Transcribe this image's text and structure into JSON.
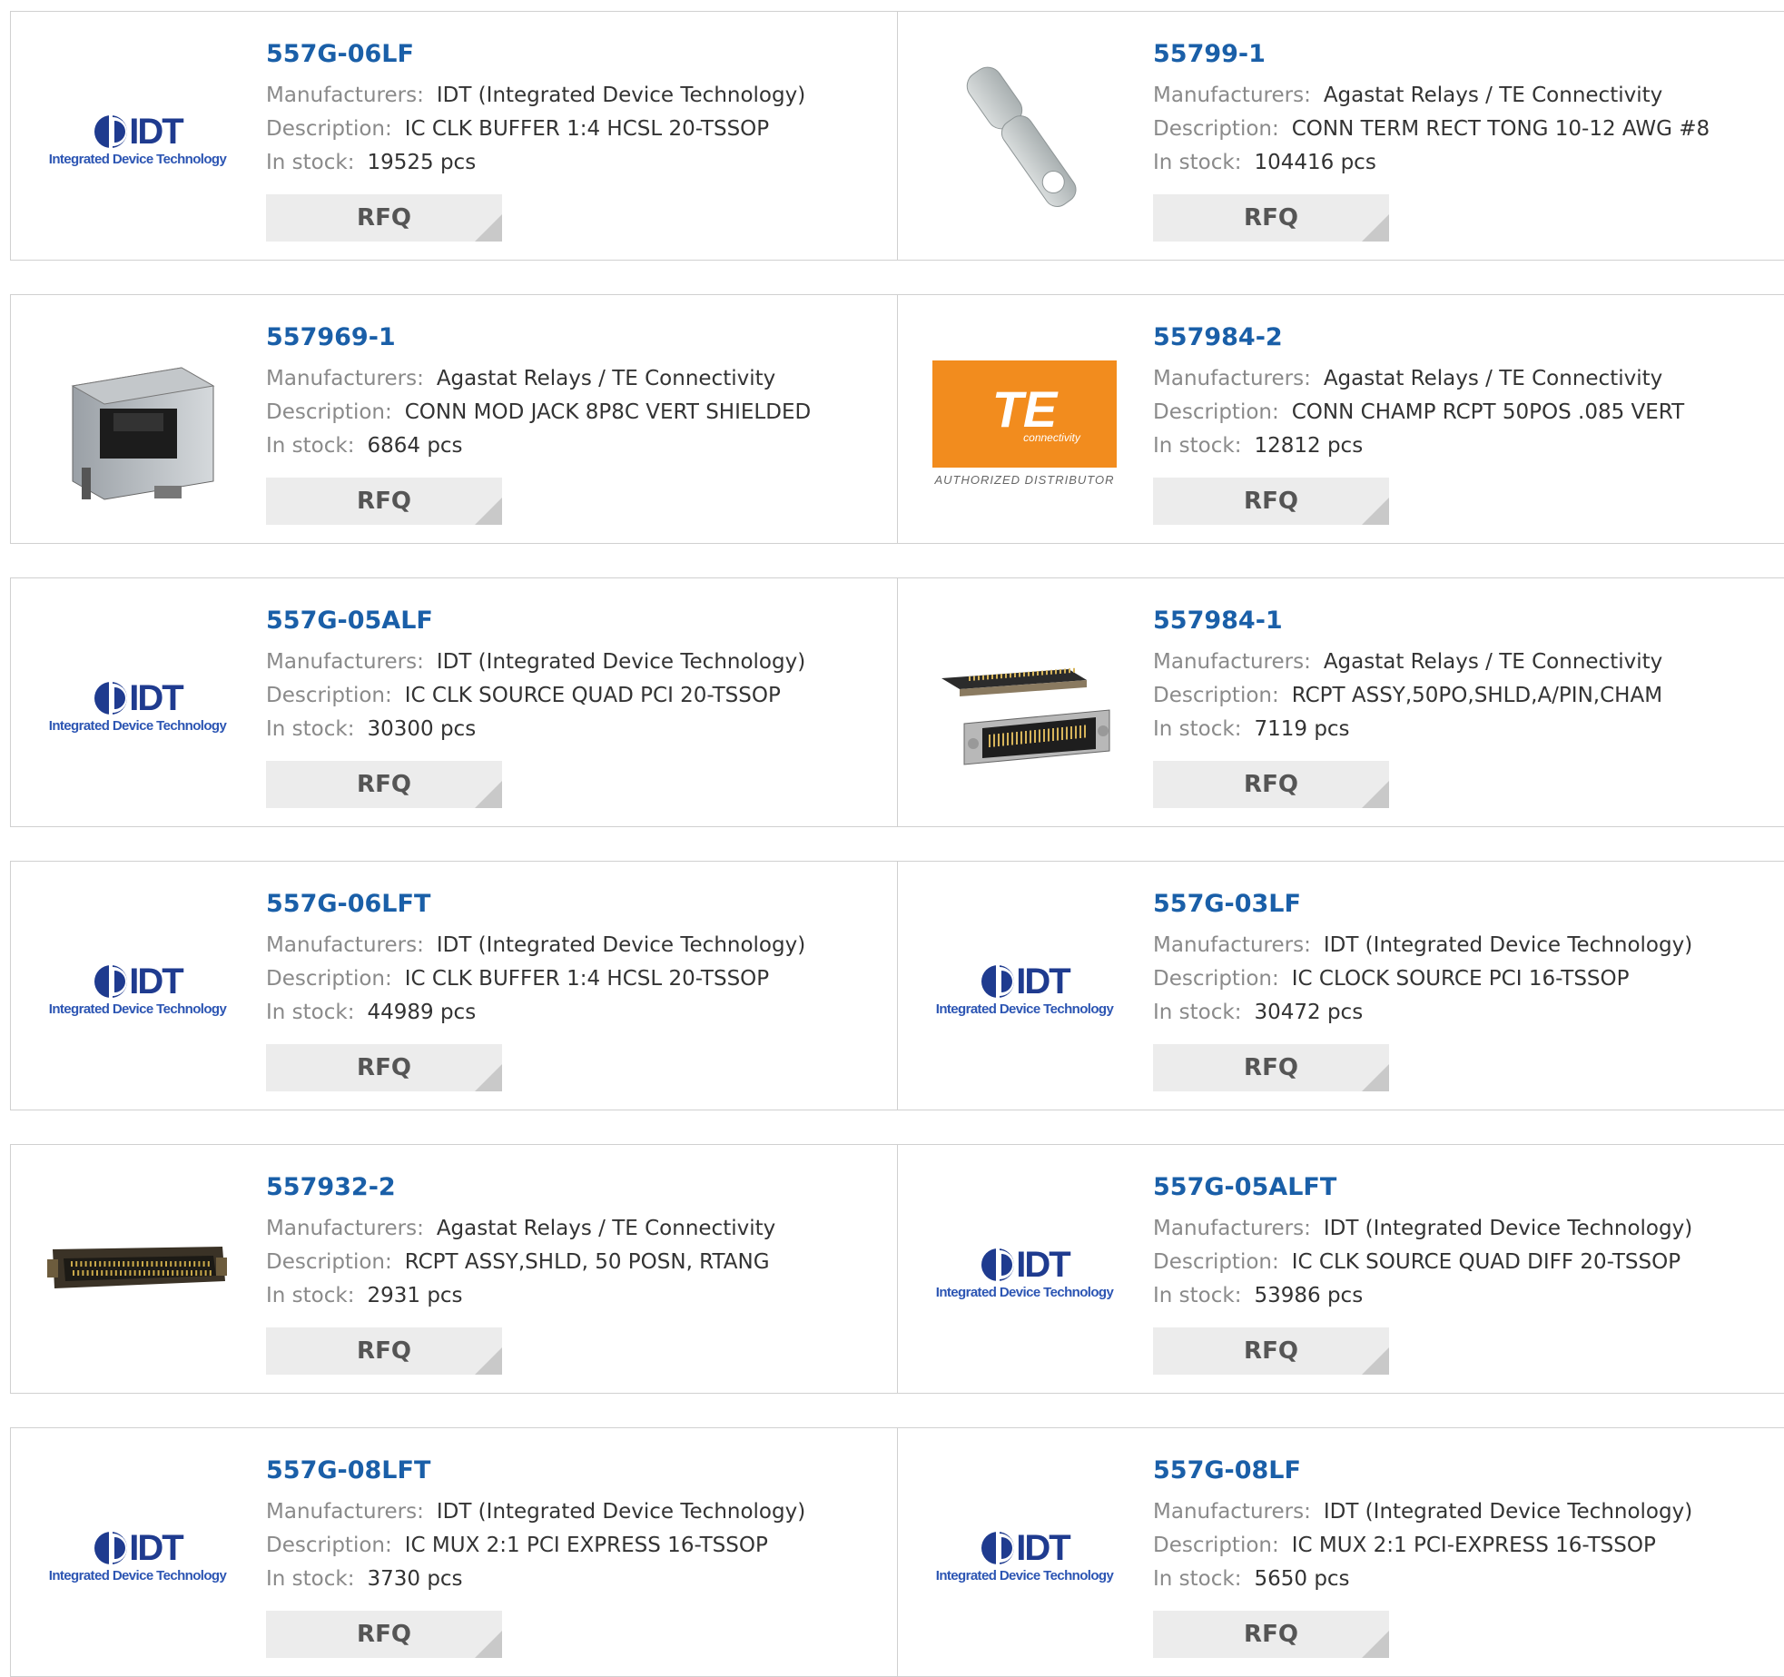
{
  "labels": {
    "manufacturers": "Manufacturers:",
    "description": "Description:",
    "in_stock": "In stock:",
    "rfq": "RFQ"
  },
  "logos": {
    "idt_word": "IDT",
    "idt_subtitle": "Integrated Device Technology",
    "te_word": "TE",
    "te_subtitle": "connectivity",
    "te_caption": "AUTHORIZED DISTRIBUTOR"
  },
  "colors": {
    "part_link": "#1a5fa8",
    "label_gray": "#8a8a8a",
    "button_bg": "#ececec",
    "te_orange": "#f28c1e",
    "idt_blue": "#1f3b8f"
  },
  "products": [
    {
      "part": "557G-06LF",
      "manufacturer": "IDT (Integrated Device Technology)",
      "description": "IC CLK BUFFER 1:4 HCSL 20-TSSOP",
      "stock": "19525 pcs",
      "image": "idt-logo"
    },
    {
      "part": "55799-1",
      "manufacturer": "Agastat Relays / TE Connectivity",
      "description": "CONN TERM RECT TONG 10-12 AWG #8",
      "stock": "104416 pcs",
      "image": "ring-terminal-photo"
    },
    {
      "part": "557969-1",
      "manufacturer": "Agastat Relays / TE Connectivity",
      "description": "CONN MOD JACK 8P8C VERT SHIELDED",
      "stock": "6864 pcs",
      "image": "modular-jack-photo"
    },
    {
      "part": "557984-2",
      "manufacturer": "Agastat Relays / TE Connectivity",
      "description": "CONN CHAMP RCPT 50POS .085 VERT",
      "stock": "12812 pcs",
      "image": "te-logo"
    },
    {
      "part": "557G-05ALF",
      "manufacturer": "IDT (Integrated Device Technology)",
      "description": "IC CLK SOURCE QUAD PCI 20-TSSOP",
      "stock": "30300 pcs",
      "image": "idt-logo"
    },
    {
      "part": "557984-1",
      "manufacturer": "Agastat Relays / TE Connectivity",
      "description": "RCPT ASSY,50PO,SHLD,A/PIN,CHAM",
      "stock": "7119 pcs",
      "image": "champ-connector-photo"
    },
    {
      "part": "557G-06LFT",
      "manufacturer": "IDT (Integrated Device Technology)",
      "description": "IC CLK BUFFER 1:4 HCSL 20-TSSOP",
      "stock": "44989 pcs",
      "image": "idt-logo"
    },
    {
      "part": "557G-03LF",
      "manufacturer": "IDT (Integrated Device Technology)",
      "description": "IC CLOCK SOURCE PCI 16-TSSOP",
      "stock": "30472 pcs",
      "image": "idt-logo"
    },
    {
      "part": "557932-2",
      "manufacturer": "Agastat Relays / TE Connectivity",
      "description": "RCPT ASSY,SHLD, 50 POSN, RTANG",
      "stock": "2931 pcs",
      "image": "right-angle-connector-photo"
    },
    {
      "part": "557G-05ALFT",
      "manufacturer": "IDT (Integrated Device Technology)",
      "description": "IC CLK SOURCE QUAD DIFF 20-TSSOP",
      "stock": "53986 pcs",
      "image": "idt-logo"
    },
    {
      "part": "557G-08LFT",
      "manufacturer": "IDT (Integrated Device Technology)",
      "description": "IC MUX 2:1 PCI EXPRESS 16-TSSOP",
      "stock": "3730 pcs",
      "image": "idt-logo"
    },
    {
      "part": "557G-08LF",
      "manufacturer": "IDT (Integrated Device Technology)",
      "description": "IC MUX 2:1 PCI-EXPRESS 16-TSSOP",
      "stock": "5650 pcs",
      "image": "idt-logo"
    }
  ]
}
